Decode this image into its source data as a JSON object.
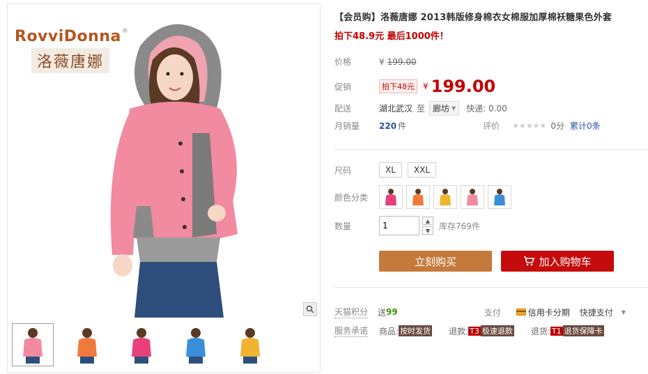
{
  "gallery": {
    "brand_en": "RovviDonna",
    "brand_mark": "®",
    "brand_cn": "洛薇唐娜",
    "thumbs": [
      {
        "color": "#f28aa0"
      },
      {
        "color": "#f07a3c"
      },
      {
        "color": "#e8407a"
      },
      {
        "color": "#3a8fd9"
      },
      {
        "color": "#f0b431"
      }
    ]
  },
  "product": {
    "title": "【会员购】洛薇唐娜 2013韩版修身棉衣女棉服加厚棉袄糖果色外套",
    "promo": "拍下48.9元 最后1000件！",
    "price_label": "价格",
    "price_currency": "¥",
    "price_original": "199.00",
    "promo_label": "促销",
    "promo_tag": "拍下48元",
    "promo_currency": "¥",
    "promo_price": "199.00",
    "ship_label": "配送",
    "ship_from": "湖北武汉",
    "ship_to_word": "至",
    "ship_dest": "廊坊",
    "ship_fee": "快递: 0.00",
    "sales_label": "月销量",
    "sales_count": "220",
    "sales_unit": "件",
    "rating_label": "评价",
    "rating_stars": "★★★★★",
    "rating_score": "0分",
    "rating_total": "累计0条",
    "size_label": "尺码",
    "sizes": [
      "XL",
      "XXL"
    ],
    "color_label": "颜色分类",
    "colors": [
      "#e8407a",
      "#f07a3c",
      "#f0b431",
      "#f28aa0",
      "#3a8fd9"
    ],
    "qty_label": "数量",
    "qty_value": "1",
    "stock": "库存769件",
    "buy_now": "立刻购买",
    "add_cart": "加入购物车",
    "points_label": "天猫积分",
    "points_text": "送",
    "points_value": "99",
    "pay_label": "支付",
    "pay_credit": "信用卡分期",
    "pay_fast": "快捷支付",
    "service_label": "服务承诺",
    "svc_goods": "商品:",
    "svc_goods_tag": "按时发货",
    "svc_refund": "退款:",
    "svc_refund_code": "T3",
    "svc_refund_tag": "极速退款",
    "svc_return": "退货:",
    "svc_return_code": "T1",
    "svc_return_tag": "退货保障卡"
  }
}
